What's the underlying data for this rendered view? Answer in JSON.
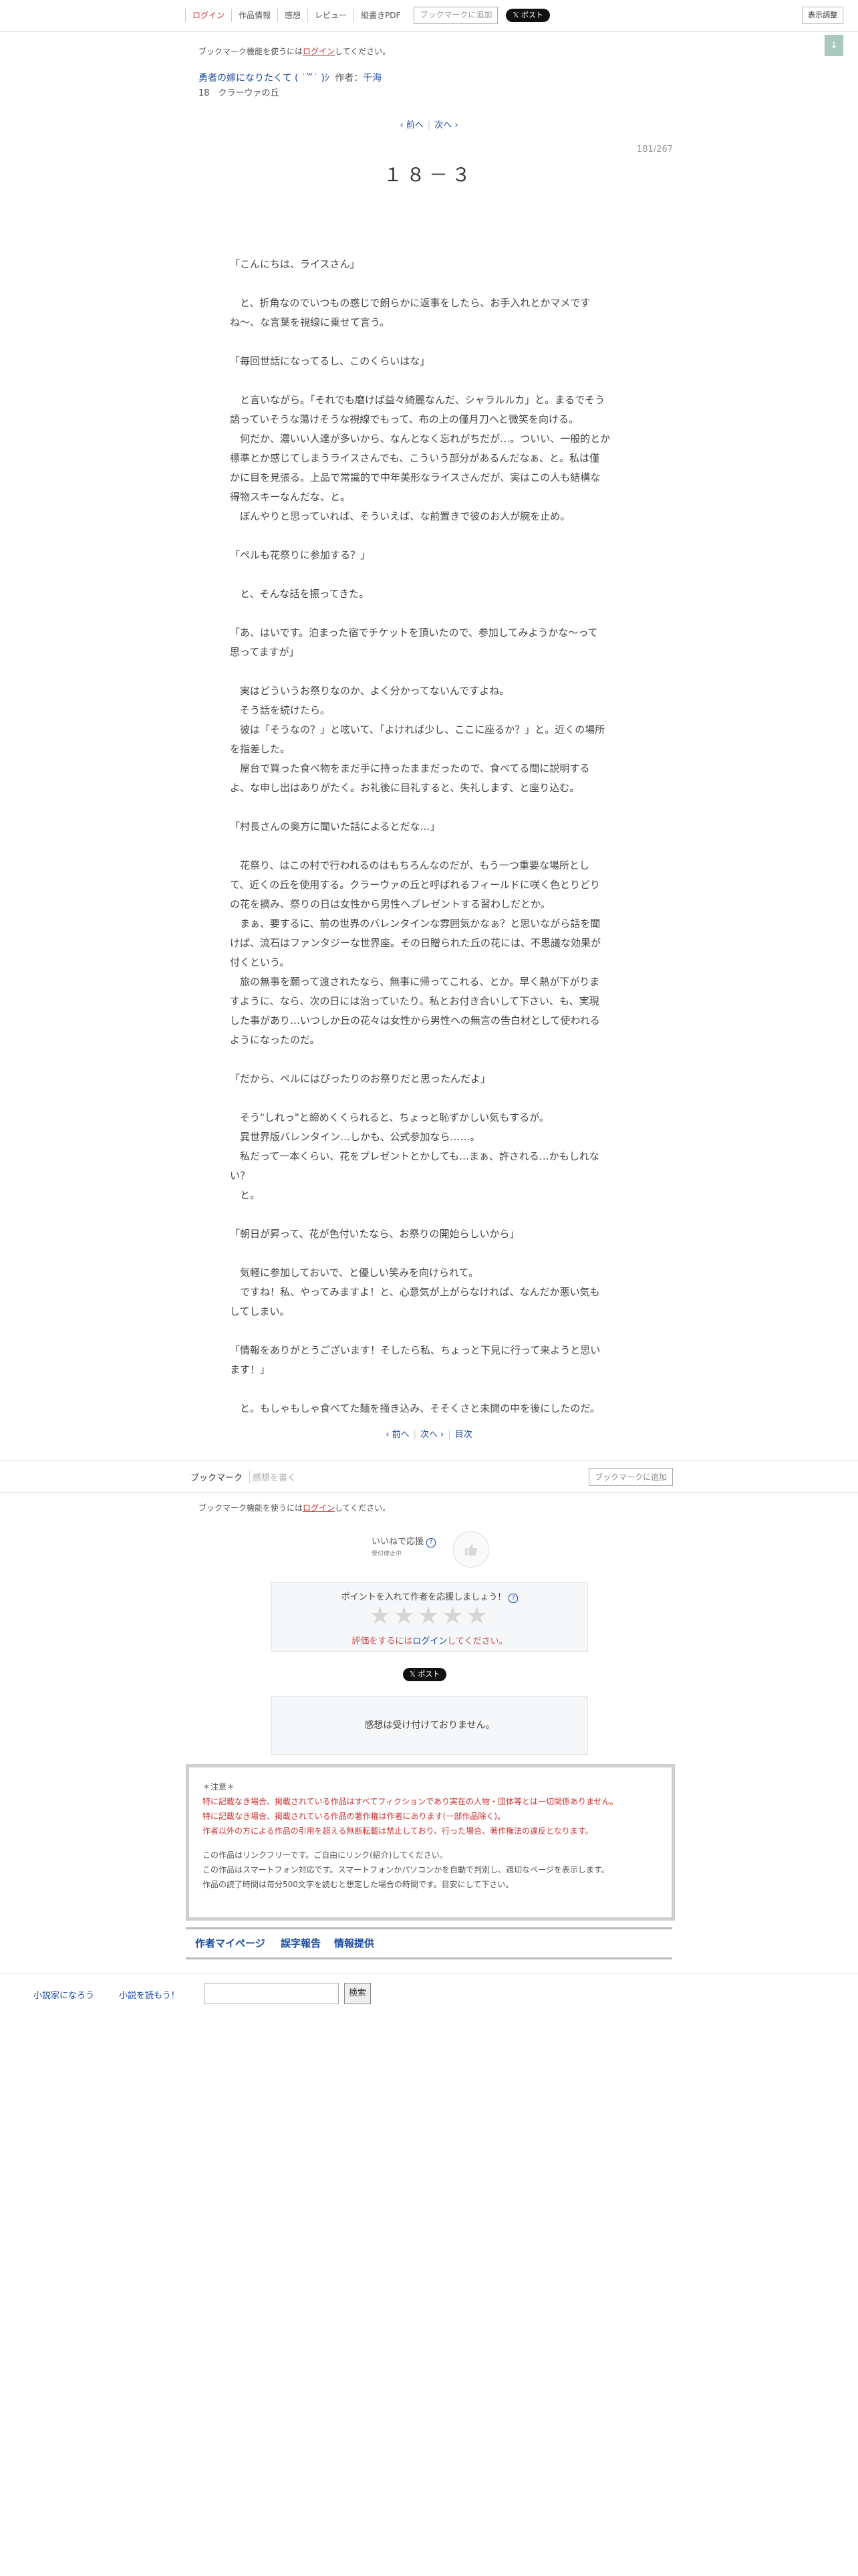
{
  "header": {
    "nav": [
      "ログイン",
      "作品情報",
      "感想",
      "レビュー",
      "縦書きPDF"
    ],
    "bookmark_add": "ブックマークに追加",
    "x_post": "𝕏 ポスト",
    "display_settings": "表示調整",
    "toc_button": "↓"
  },
  "notice": {
    "prefix": "ブックマーク機能を使うには",
    "login": "ログイン",
    "suffix": "してください。"
  },
  "series": {
    "title": "勇者の嫁になりたくて ( ˙꒳˙ )ｼ",
    "author_label": "作者：",
    "author": "千海"
  },
  "chapter": "18　クラーウァの丘",
  "pager": {
    "prev": "‹ 前へ",
    "next": "次へ ›",
    "toc": "目次"
  },
  "page_no": "181/267",
  "subtitle": "１８－３",
  "body": [
    "",
    "「こんにちは、ライスさん」",
    "",
    "　と、折角なのでいつもの感じで朗らかに返事をしたら、お手入れとかマメです",
    "ね〜、な言葉を視線に乗せて言う。",
    "",
    "「毎回世話になってるし、このくらいはな」",
    "",
    "　と言いながら。「それでも磨けば益々綺麗なんだ、シャラルルカ」と。まるでそう",
    "語っていそうな蕩けそうな視線でもって、布の上の僅月刀へと微笑を向ける。",
    "　何だか、濃いい人達が多いから、なんとなく忘れがちだが…。ついい、一般的とか",
    "標準とか感じてしまうライスさんでも、こういう部分があるんだなぁ、と。私は僅",
    "かに目を見張る。上品で常識的で中年美形なライスさんだが、実はこの人も結構な",
    "得物スキーなんだな、と。",
    "　ぼんやりと思っていれば、そういえば、な前置きで彼のお人が腕を止め。",
    "",
    "「ペルも花祭りに参加する？」",
    "",
    "　と、そんな話を振ってきた。",
    "",
    "「あ、はいです。泊まった宿でチケットを頂いたので、参加してみようかな〜って",
    "思ってますが」",
    "",
    "　実はどういうお祭りなのか、よく分かってないんですよね。",
    "　そう話を続けたら。",
    "　彼は「そうなの？」と呟いて、「よければ少し、ここに座るか？」と。近くの場所",
    "を指差した。",
    "　屋台で買った食べ物をまだ手に持ったままだったので、食べてる間に説明する",
    "よ、な申し出はありがたく。お礼後に目礼すると、失礼します、と座り込む。",
    "",
    "「村長さんの奥方に聞いた話によるとだな…」",
    "",
    "　花祭り、はこの村で行われるのはもちろんなのだが、もう一つ重要な場所とし",
    "て、近くの丘を使用する。クラーウァの丘と呼ばれるフィールドに咲く色とりどり",
    "の花を摘み、祭りの日は女性から男性へプレゼントする習わしだとか。",
    "　まぁ、要するに、前の世界のバレンタインな雰囲気かなぁ？と思いながら話を聞",
    "けば、流石はファンタジーな世界座。その日贈られた丘の花には、不思議な効果が",
    "付くという。",
    "　旅の無事を願って渡されたなら、無事に帰ってこれる、とか。早く熱が下がりま",
    "すように、なら、次の日には治っていたり。私とお付き合いして下さい、も、実現",
    "した事があり…いつしか丘の花々は女性から男性への無言の告白材として使われる",
    "ようになったのだ。",
    "",
    "「だから、ペルにはぴったりのお祭りだと思ったんだよ」",
    "",
    "　そう\"しれっ\"と締めくくられると、ちょっと恥ずかしい気もするが。",
    "　異世界版バレンタイン…しかも、公式参加なら……。",
    "　私だって一本くらい、花をプレゼントとかしても…まぁ、許される…かもしれな",
    "い？",
    "　と。",
    "",
    "「朝日が昇って、花が色付いたなら、お祭りの開始らしいから」",
    "",
    "　気軽に参加しておいで、と優しい笑みを向けられて。",
    "　ですね！私、やってみますよ！と、心意気が上がらなければ、なんだか悪い気も",
    "してしまい。",
    "",
    "「情報をありがとうございます！そしたら私、ちょっと下見に行って来ようと思い",
    "ます！」",
    "",
    "　と。もしゃもしゃ食べてた麺を掻き込み、そそくさと未開の中を後にしたのだ。"
  ],
  "bookmark_bar": {
    "label": "ブックマーク",
    "impression": "感想を書く",
    "add": "ブックマークに追加"
  },
  "like": {
    "label": "いいねで応援",
    "help": "?",
    "sub": "受付停止中",
    "icon": "thumbs-up"
  },
  "rating": {
    "prompt": "ポイントを入れて作者を応援しましょう！",
    "help": "?",
    "stars": "★★★★★",
    "req_prefix": "評価をするには",
    "req_login": "ログイン",
    "req_suffix": "してください。"
  },
  "x_post": "𝕏 ポスト",
  "impressions_closed": "感想は受け付けておりません。",
  "caution": {
    "head": "＊注意＊",
    "red_lines": [
      "特に記載なき場合、掲載されている作品はすべてフィクションであり実在の人物・団体等とは一切関係ありません。",
      "特に記載なき場合、掲載されている作品の著作権は作者にあります(一部作品除く)。",
      "作者以外の方による作品の引用を超える無断転載は禁止しており、行った場合、著作権法の違反となります。"
    ],
    "gray_lines": [
      "この作品はリンクフリーです。ご自由にリンク(紹介)してください。",
      "この作品はスマートフォン対応です。スマートフォンかパソコンかを自動で判別し、適切なページを表示します。",
      "作品の読了時間は毎分500文字を読むと想定した場合の時間です。目安にして下さい。"
    ]
  },
  "links": [
    "作者マイページ",
    "誤字報告",
    "情報提供"
  ],
  "footer": {
    "link1": "小説家になろう",
    "link2": "小説を読もう！",
    "search_btn": "検索"
  },
  "colors": {
    "link": "#1a4aa0",
    "alert": "#d03030",
    "panel": "#f5f7f9"
  }
}
